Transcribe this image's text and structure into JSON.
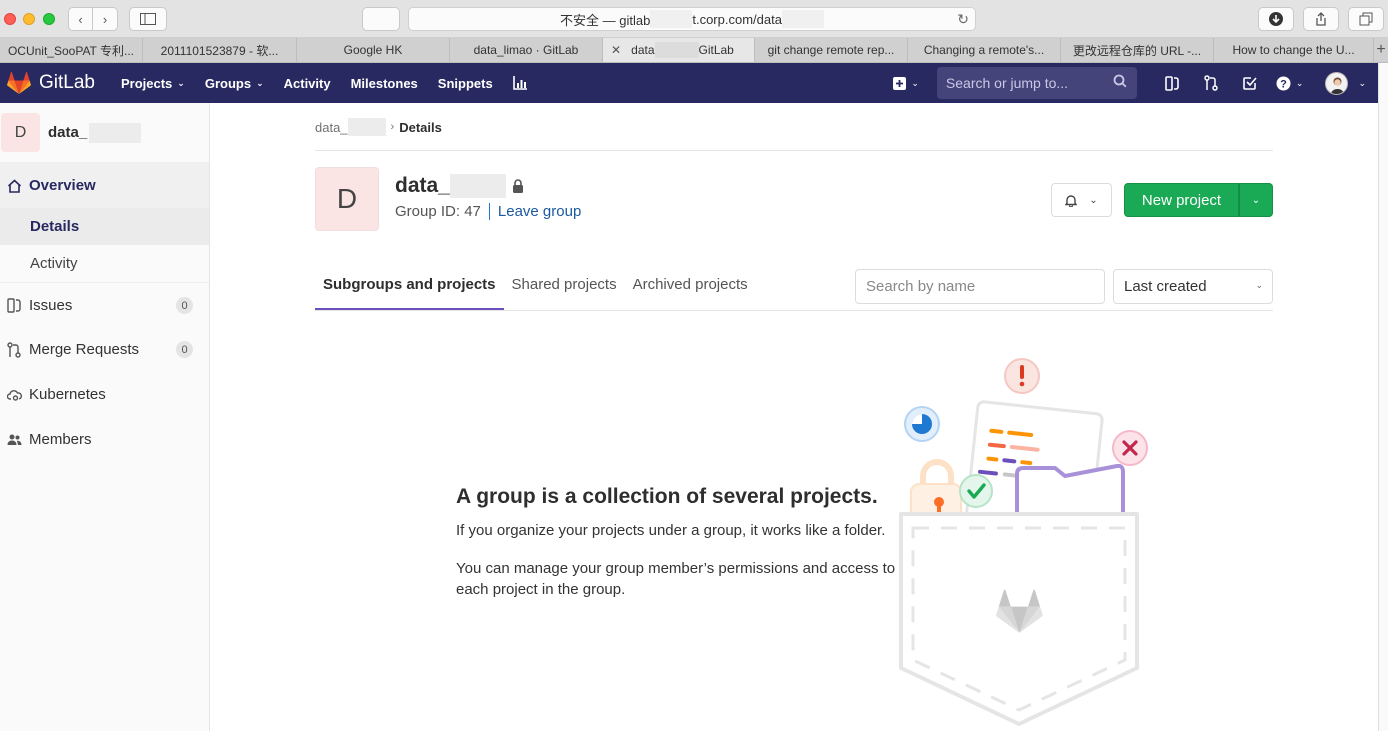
{
  "browser": {
    "url_prefix": "不安全 — gitlab",
    "url_suffix": "t.corp.com/data",
    "tabs": [
      {
        "label": "OCUnit_SooPAT 专利...",
        "width": 143
      },
      {
        "label": "2011101523879 - 软...",
        "width": 154
      },
      {
        "label": "Google HK",
        "width": 153
      },
      {
        "label": "data_limao · GitLab",
        "width": 153
      },
      {
        "label": "data",
        "label2": "GitLab",
        "width": 152,
        "active": true
      },
      {
        "label": "git change remote rep...",
        "width": 153
      },
      {
        "label": "Changing a remote's...",
        "width": 153
      },
      {
        "label": "更改远程仓库的 URL -...",
        "width": 153
      },
      {
        "label": "How to change the U...",
        "width": 160
      }
    ]
  },
  "header": {
    "logo_text": "GitLab",
    "nav": [
      "Projects",
      "Groups",
      "Activity",
      "Milestones",
      "Snippets"
    ],
    "search_placeholder": "Search or jump to..."
  },
  "sidebar": {
    "avatar_letter": "D",
    "group_name": "data_",
    "overview_label": "Overview",
    "details_label": "Details",
    "activity_label": "Activity",
    "issues_label": "Issues",
    "issues_count": "0",
    "mr_label": "Merge Requests",
    "mr_count": "0",
    "kubernetes_label": "Kubernetes",
    "members_label": "Members"
  },
  "breadcrumb": {
    "parent": "data_",
    "current": "Details"
  },
  "group": {
    "avatar_letter": "D",
    "name": "data_",
    "id_label": "Group ID: 47",
    "leave_label": "Leave group"
  },
  "actions": {
    "new_project_label": "New project"
  },
  "tabs": {
    "subgroups": "Subgroups and projects",
    "shared": "Shared projects",
    "archived": "Archived projects",
    "search_placeholder": "Search by name",
    "sort_value": "Last created"
  },
  "empty_state": {
    "title": "A group is a collection of several projects.",
    "p1": "If you organize your projects under a group, it works like a folder.",
    "p2": "You can manage your group member’s permissions and access to each project in the group."
  },
  "colors": {
    "header_bg": "#292961",
    "primary_green": "#1aaa55",
    "link_blue": "#1b5aa0",
    "active_tab_underline": "#6b4fbb"
  }
}
